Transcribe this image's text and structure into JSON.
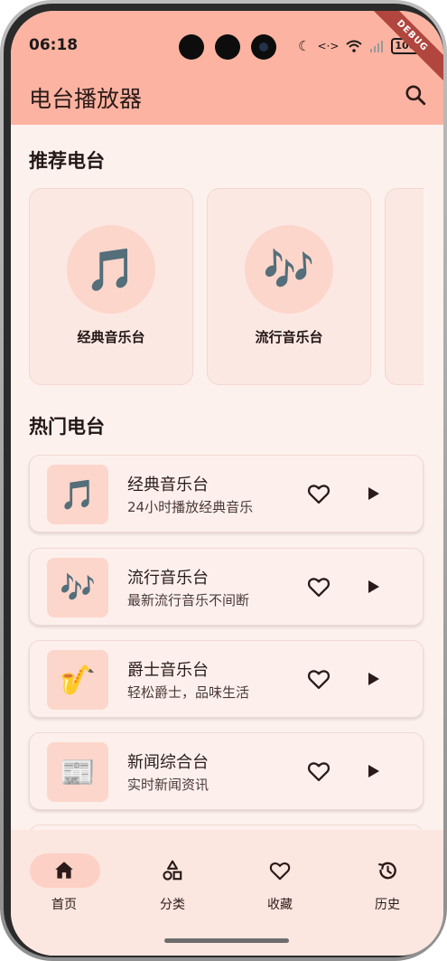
{
  "status_bar": {
    "time": "06:18",
    "icons": [
      "moon-icon",
      "nfc-icon",
      "wifi-icon",
      "signal-icon"
    ],
    "battery": "100",
    "debug_banner": "DEBUG"
  },
  "app_bar": {
    "title": "电台播放器",
    "search_icon": "search-icon"
  },
  "recommended": {
    "title": "推荐电台",
    "items": [
      {
        "label": "经典音乐台",
        "icon": "🎵"
      },
      {
        "label": "流行音乐台",
        "icon": "🎶"
      }
    ]
  },
  "hot": {
    "title": "热门电台",
    "items": [
      {
        "name": "经典音乐台",
        "desc": "24小时播放经典音乐",
        "icon": "🎵"
      },
      {
        "name": "流行音乐台",
        "desc": "最新流行音乐不间断",
        "icon": "🎶"
      },
      {
        "name": "爵士音乐台",
        "desc": "轻松爵士，品味生活",
        "icon": "🎷"
      },
      {
        "name": "新闻综合台",
        "desc": "实时新闻资讯",
        "icon": "📰"
      }
    ]
  },
  "bottom_nav": {
    "items": [
      {
        "label": "首页",
        "icon": "home-icon",
        "active": true
      },
      {
        "label": "分类",
        "icon": "category-icon",
        "active": false
      },
      {
        "label": "收藏",
        "icon": "heart-icon",
        "active": false
      },
      {
        "label": "历史",
        "icon": "history-icon",
        "active": false
      }
    ]
  },
  "colors": {
    "app_bar": "#fdb3a1",
    "background": "#fdf1ee",
    "card": "#fdf0ec",
    "icon_container": "#fcd6cb",
    "nav_bar": "#fce6e0",
    "nav_active_pill": "#fcd0c4"
  }
}
